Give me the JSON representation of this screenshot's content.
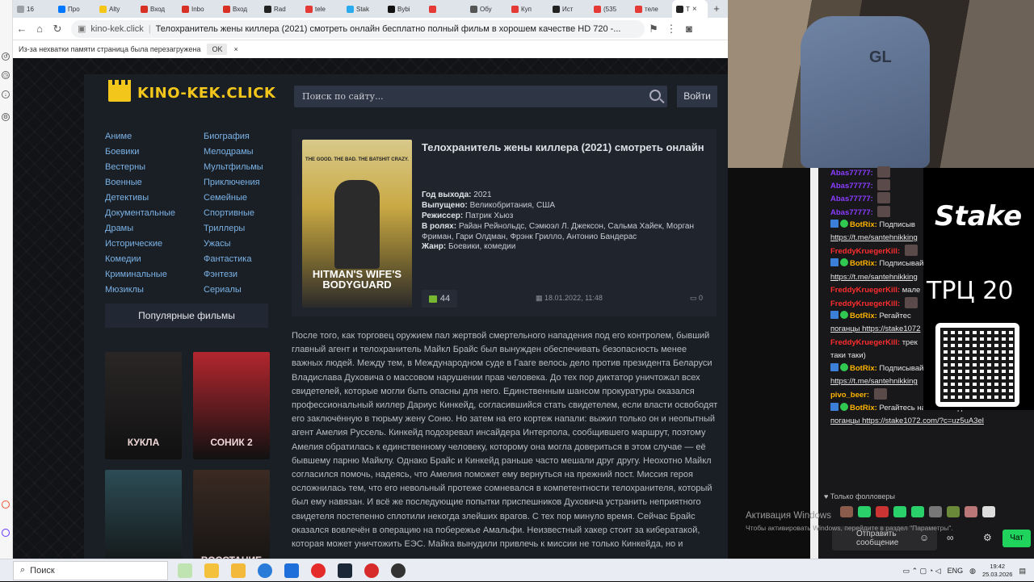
{
  "browser": {
    "tabs": [
      {
        "label": "16",
        "color": "#9aa0a6"
      },
      {
        "label": "Про",
        "color": "#0077ff"
      },
      {
        "label": "Alty",
        "color": "#f5c518"
      },
      {
        "label": "Вход",
        "color": "#d93025"
      },
      {
        "label": "Inbo",
        "color": "#d93025"
      },
      {
        "label": "Вход",
        "color": "#d93025"
      },
      {
        "label": "Rad",
        "color": "#222222"
      },
      {
        "label": "tele",
        "color": "#e53935"
      },
      {
        "label": "Stak",
        "color": "#2aabee"
      },
      {
        "label": "Bybi",
        "color": "#111111"
      },
      {
        "label": "",
        "color": "#e53935"
      },
      {
        "label": "Обу",
        "color": "#555555"
      },
      {
        "label": "Куп",
        "color": "#e53935"
      },
      {
        "label": "Ист",
        "color": "#222222"
      },
      {
        "label": "(535",
        "color": "#e53935"
      },
      {
        "label": "теле",
        "color": "#e53935"
      },
      {
        "label": "Т",
        "color": "#222222",
        "active": true
      }
    ],
    "url_host": "kino-kek.click",
    "url_title": "Телохранитель жены киллера (2021) смотреть онлайн бесплатно полный фильм в хорошем качестве HD 720 -...",
    "infobar_text": "Из-за нехватки памяти страница была перезагружена",
    "infobar_ok": "OK",
    "infobar_close": "×"
  },
  "site": {
    "logo": "KINO-KEK.CLICK",
    "search_placeholder": "Поиск по сайту...",
    "login": "Войти",
    "genres_left": [
      "Аниме",
      "Боевики",
      "Вестерны",
      "Военные",
      "Детективы",
      "Документальные",
      "Драмы",
      "Исторические",
      "Комедии",
      "Криминальные",
      "Мюзиклы"
    ],
    "genres_right": [
      "Биография",
      "Мелодрамы",
      "Мультфильмы",
      "Приключения",
      "Семейные",
      "Спортивные",
      "Триллеры",
      "Ужасы",
      "Фантастика",
      "Фэнтези",
      "Сериалы"
    ],
    "popular_heading": "Популярные фильмы",
    "popular_posters": [
      {
        "text": "КУКЛА",
        "bg": "#2a2626"
      },
      {
        "text": "СОНИК 2",
        "bg": "#b3262e"
      },
      {
        "text": "",
        "bg": "#2c4c55"
      },
      {
        "text": "ВОССТАНИЕ",
        "bg": "#3a2a22"
      }
    ],
    "movie": {
      "title": "Телохранитель жены киллера (2021) смотреть онлайн",
      "poster_caption": "HITMAN'S WIFE'S BODYGUARD",
      "poster_tagline": "THE GOOD. THE BAD. THE BATSHIT CRAZY.",
      "year_label": "Год выхода:",
      "year": "2021",
      "country_label": "Выпущено:",
      "country": "Великобритания, США",
      "director_label": "Режиссер:",
      "director": "Патрик Хьюз",
      "cast_label": "В ролях:",
      "cast": "Райан Рейнольдс, Сэмюэл Л. Джексон, Сальма Хайек, Морган Фриман, Гари Олдман, Фрэнк Грилло, Антонио Бандерас",
      "genre_label": "Жанр:",
      "genre": "Боевики, комедии",
      "likes": "44",
      "date": "18.01.2022, 11:48",
      "comments": "0"
    },
    "description": "После того, как торговец оружием пал жертвой смертельного нападения под его контролем, бывший главный агент и телохранитель Майкл Брайс был вынужден обеспечивать безопасность менее важных людей. Между тем, в Международном суде в Гааге велось дело против президента Беларуси Владислава Духовича о массовом нарушении прав человека. До тех пор диктатор уничтожал всех свидетелей, которые могли быть опасны для него. Единственным шансом прокуратуры оказался профессиональный киллер Дариус Кинкейд, согласившийся стать свидетелем, если власти освободят его заключённую в тюрьму жену Соню. Но затем на его кортеж напали: выжил только он и неопытный агент Амелия Руссель. Кинкейд подозревал инсайдера Интерпола, сообщившего маршрут, поэтому Амелия обратилась к единственному человеку, которому она могла довериться в этом случае — её бывшему парню Майклу. Однако Брайс и Кинкейд раньше часто мешали друг другу. Неохотно Майкл согласился помочь, надеясь, что Амелия поможет ему вернуться на прежний пост. Миссия героя осложнилась тем, что его невольный протеже сомневался в компетентности телохранителя, который был ему навязан. И всё же последующие попытки приспешников Духовича устранить неприятного свидетеля постепенно сплотили некогда злейших врагов. С тех пор минуло время. Сейчас Брайс оказался вовлечён в операцию на побережье Амальфи. Неизвестный хакер стоит за кибератакой, которая может уничтожить ЕЭС. Майка вынудили привлечь к миссии не только Кинкейда, но и"
  },
  "chat": {
    "messages": [
      {
        "user": "Abas77777:",
        "cls": "u-abs",
        "text": ""
      },
      {
        "user": "Abas77777:",
        "cls": "u-abs",
        "text": ""
      },
      {
        "user": "Abas77777:",
        "cls": "u-abs",
        "text": ""
      },
      {
        "user": "Abas77777:",
        "cls": "u-abs",
        "text": ""
      },
      {
        "user": "BotRix:",
        "cls": "u-bot",
        "text": "Подписыв"
      },
      {
        "user": "",
        "cls": "",
        "text": "https://t.me/santehnikking"
      },
      {
        "user": "FreddyKruegerKill:",
        "cls": "u-fk",
        "text": ""
      },
      {
        "user": "BotRix:",
        "cls": "u-bot",
        "text": "Подписывай"
      },
      {
        "user": "",
        "cls": "",
        "text": "https://t.me/santehnikking"
      },
      {
        "user": "FreddyKruegerKill:",
        "cls": "u-fk",
        "text": "мале"
      },
      {
        "user": "FreddyKruegerKill:",
        "cls": "u-fk",
        "text": ""
      },
      {
        "user": "BotRix:",
        "cls": "u-bot",
        "text": "Регайтес"
      },
      {
        "user": "",
        "cls": "",
        "text": "поганцы https://stake1072"
      },
      {
        "user": "FreddyKruegerKill:",
        "cls": "u-fk",
        "text": "трек"
      },
      {
        "user": "",
        "cls": "",
        "text": "таки таки)"
      },
      {
        "user": "BotRix:",
        "cls": "u-bot",
        "text": "Подписывайтесь на мой ТГ канал"
      },
      {
        "user": "",
        "cls": "",
        "text": "https://t.me/santehnikking"
      },
      {
        "user": "pivo_beer:",
        "cls": "u-pivo",
        "text": ""
      },
      {
        "user": "BotRix:",
        "cls": "u-bot",
        "text": "Регайтесь на Stake под меня"
      },
      {
        "user": "",
        "cls": "",
        "text": "поганцы https://stake1072.com/?c=uz5uA3el"
      }
    ],
    "followers_only": "Только фолловеры",
    "input_placeholder": "Отправить сообщение",
    "send": "Чат",
    "stake_logo": "Stake",
    "trc": "ТРЦ 20"
  },
  "windows": {
    "activation_title": "Активация Windows",
    "activation_sub": "Чтобы активировать Windows, перейдите в раздел \"Параметры\".",
    "search": "Поиск",
    "lang": "ENG",
    "time": "19:42",
    "date": "25.03.2026"
  },
  "colors": {
    "accent": "#f3c61b",
    "link": "#7bb3e6",
    "chat_bg": "#18181b",
    "send": "#1fd35c"
  }
}
